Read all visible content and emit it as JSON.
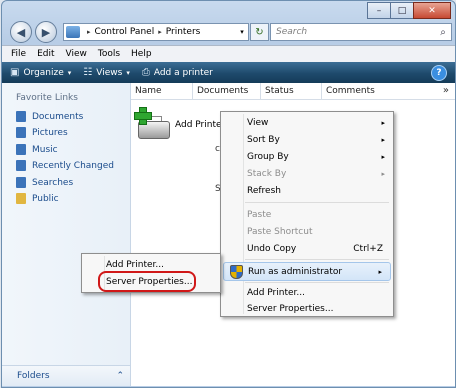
{
  "titlebar": {
    "minimize_glyph": "–",
    "maximize_glyph": "□",
    "close_glyph": "✕"
  },
  "nav": {
    "back_glyph": "◀",
    "forward_glyph": "▶",
    "address": {
      "segments": [
        "Control Panel",
        "Printers"
      ],
      "separator": "▸",
      "dropdown_glyph": "▾"
    },
    "refresh_glyph": "↻",
    "search_placeholder": "Search",
    "search_icon_glyph": "⌕"
  },
  "menubar": {
    "items": [
      "File",
      "Edit",
      "View",
      "Tools",
      "Help"
    ]
  },
  "commandbar": {
    "organize": {
      "label": "Organize",
      "glyph": "▣",
      "caret": "▾"
    },
    "views": {
      "label": "Views",
      "glyph": "☷",
      "caret": "▾"
    },
    "add_printer": {
      "label": "Add a printer",
      "glyph": "⎙"
    },
    "help_glyph": "?"
  },
  "sidebar": {
    "title": "Favorite Links",
    "items": [
      {
        "label": "Documents",
        "icon": "documents-icon",
        "color": "#3b73b9"
      },
      {
        "label": "Pictures",
        "icon": "pictures-icon",
        "color": "#3b73b9"
      },
      {
        "label": "Music",
        "icon": "music-icon",
        "color": "#3b73b9"
      },
      {
        "label": "Recently Changed",
        "icon": "recently-changed-icon",
        "color": "#3b73b9"
      },
      {
        "label": "Searches",
        "icon": "searches-icon",
        "color": "#3b73b9"
      },
      {
        "label": "Public",
        "icon": "public-folder-icon",
        "color": "#e1b640"
      }
    ],
    "folders": {
      "label": "Folders",
      "chevron_glyph": "⌃"
    }
  },
  "filelist": {
    "columns": [
      "Name",
      "Documents",
      "Status",
      "Comments"
    ],
    "more_glyph": "»",
    "item": {
      "label": "Add Printer"
    },
    "partial_glyphs": [
      "c",
      "S"
    ]
  },
  "context_menu": {
    "items": [
      {
        "label": "View",
        "submenu": "▸"
      },
      {
        "label": "Sort By",
        "submenu": "▸"
      },
      {
        "label": "Group By",
        "submenu": "▸"
      },
      {
        "label": "Stack By",
        "submenu": "▸",
        "disabled": true
      },
      {
        "label": "Refresh"
      },
      {
        "label": "Paste",
        "disabled": true
      },
      {
        "label": "Paste Shortcut",
        "disabled": true
      },
      {
        "label": "Undo Copy",
        "shortcut": "Ctrl+Z"
      },
      {
        "label": "Run as administrator",
        "submenu": "▸",
        "highlighted": true
      },
      {
        "label": "Add Printer..."
      },
      {
        "label": "Server Properties..."
      }
    ]
  },
  "submenu": {
    "items": [
      {
        "label": "Add Printer..."
      },
      {
        "label": "Server Properties...",
        "boxed": true
      }
    ]
  }
}
